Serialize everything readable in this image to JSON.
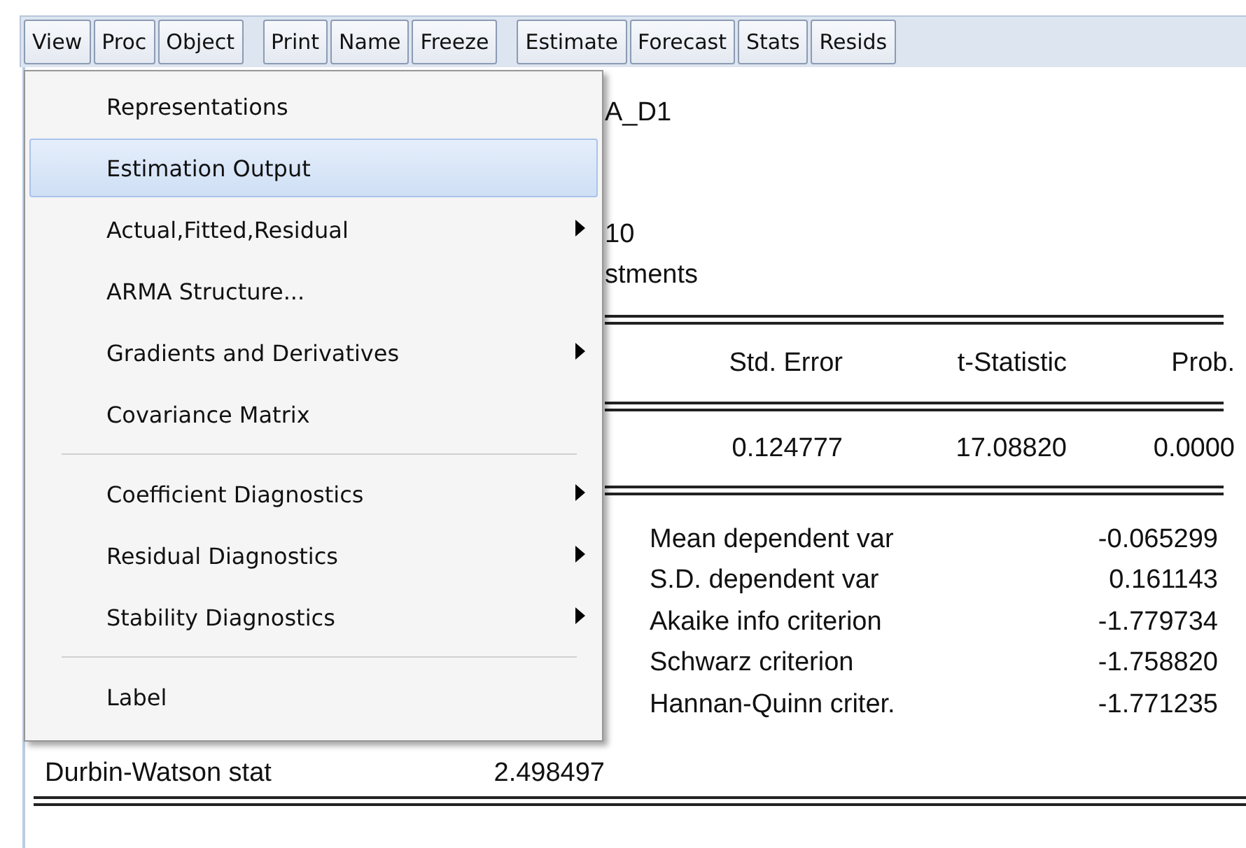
{
  "toolbar": {
    "groups": [
      [
        {
          "label": "View"
        },
        {
          "label": "Proc"
        },
        {
          "label": "Object"
        }
      ],
      [
        {
          "label": "Print"
        },
        {
          "label": "Name"
        },
        {
          "label": "Freeze"
        }
      ],
      [
        {
          "label": "Estimate"
        },
        {
          "label": "Forecast"
        },
        {
          "label": "Stats"
        },
        {
          "label": "Resids"
        }
      ]
    ]
  },
  "menu": {
    "items": [
      {
        "kind": "item",
        "label": "Representations",
        "submenu": false,
        "selected": false
      },
      {
        "kind": "item",
        "label": "Estimation Output",
        "submenu": false,
        "selected": true
      },
      {
        "kind": "item",
        "label": "Actual,Fitted,Residual",
        "submenu": true,
        "selected": false
      },
      {
        "kind": "item",
        "label": "ARMA Structure...",
        "submenu": false,
        "selected": false
      },
      {
        "kind": "item",
        "label": "Gradients and Derivatives",
        "submenu": true,
        "selected": false
      },
      {
        "kind": "item",
        "label": "Covariance Matrix",
        "submenu": false,
        "selected": false
      },
      {
        "kind": "separator"
      },
      {
        "kind": "item",
        "label": "Coefficient Diagnostics",
        "submenu": true,
        "selected": false
      },
      {
        "kind": "item",
        "label": "Residual Diagnostics",
        "submenu": true,
        "selected": false
      },
      {
        "kind": "item",
        "label": "Stability Diagnostics",
        "submenu": true,
        "selected": false
      },
      {
        "kind": "separator"
      },
      {
        "kind": "item",
        "label": "Label",
        "submenu": false,
        "selected": false
      }
    ]
  },
  "output": {
    "title_fragment": "A_D1",
    "lines": [
      "10",
      "stments"
    ],
    "table": {
      "columns": [
        "Std. Error",
        "t-Statistic",
        "Prob."
      ],
      "rows": [
        [
          "0.124777",
          "17.08820",
          "0.0000"
        ]
      ]
    },
    "stats": [
      {
        "label": "Mean dependent var",
        "value": "-0.065299"
      },
      {
        "label": "S.D. dependent var",
        "value": "0.161143"
      },
      {
        "label": "Akaike info criterion",
        "value": "-1.779734"
      },
      {
        "label": "Schwarz criterion",
        "value": "-1.758820"
      },
      {
        "label": "Hannan-Quinn criter.",
        "value": "-1.771235"
      }
    ],
    "durbin": {
      "label": "Durbin-Watson stat",
      "value": "2.498497"
    }
  }
}
